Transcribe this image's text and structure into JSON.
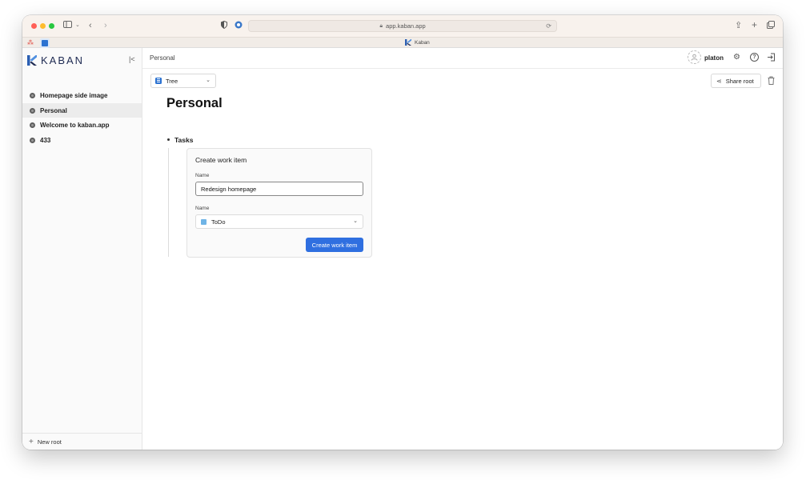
{
  "browser": {
    "url": "app.kaban.app",
    "tab_title": "Kaban"
  },
  "sidebar": {
    "brand": "KABAN",
    "items": [
      {
        "label": "Homepage side image"
      },
      {
        "label": "Personal"
      },
      {
        "label": "Welcome to kaban.app"
      },
      {
        "label": "433"
      }
    ],
    "new_root": "New root"
  },
  "header": {
    "breadcrumb": "Personal",
    "username": "platon"
  },
  "toolbar": {
    "view_mode": "Tree",
    "share_label": "Share root"
  },
  "page": {
    "title": "Personal",
    "section": "Tasks"
  },
  "form": {
    "title": "Create work item",
    "name_label": "Name",
    "name_value": "Redesign homepage",
    "status_label": "Name",
    "status_value": "ToDo",
    "submit_label": "Create work item"
  },
  "colors": {
    "accent": "#2f6fe0",
    "status_todo": "#6fb4e6",
    "brand_dark": "#1e2a52"
  }
}
